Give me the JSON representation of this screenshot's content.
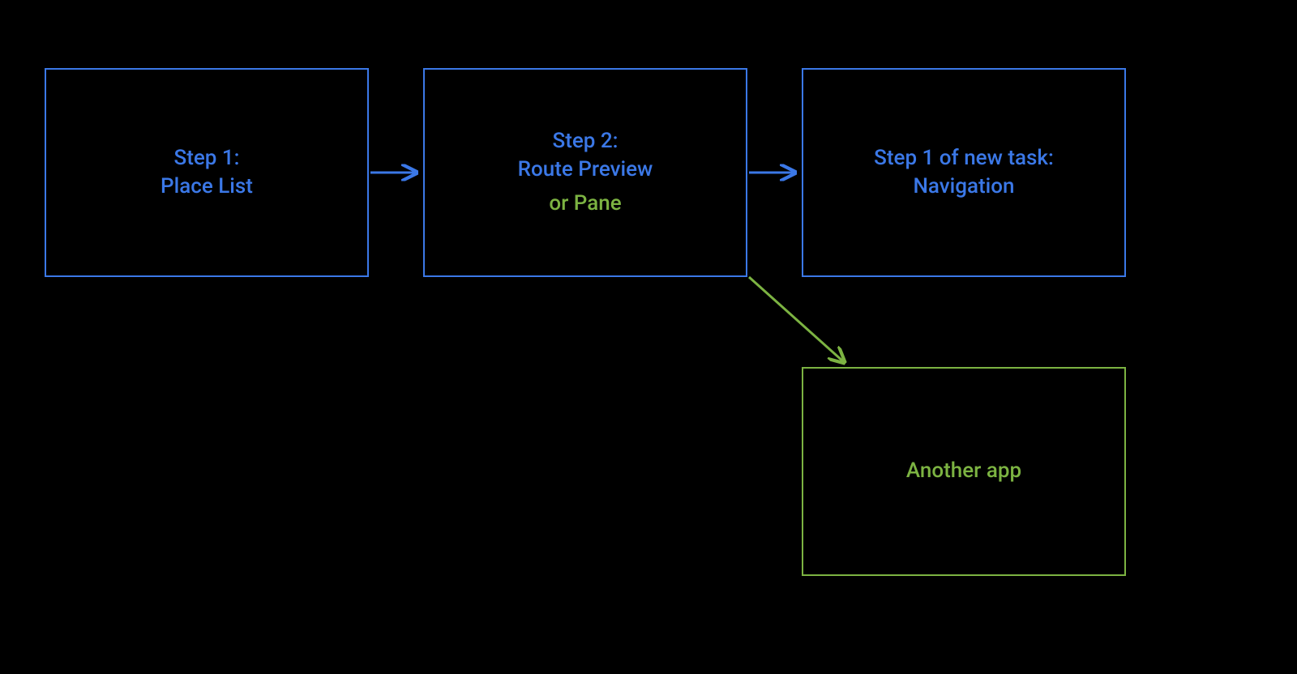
{
  "diagram": {
    "boxes": {
      "step1": {
        "title": "Step 1:",
        "subtitle": "Place List"
      },
      "step2": {
        "title": "Step 2:",
        "subtitle": "Route Preview",
        "alt": "or Pane"
      },
      "step3": {
        "title": "Step 1 of new task:",
        "subtitle": "Navigation"
      },
      "another": {
        "title": "Another app"
      }
    },
    "colors": {
      "blue": "#3b78e7",
      "green": "#7cb342",
      "background": "#000000"
    }
  }
}
